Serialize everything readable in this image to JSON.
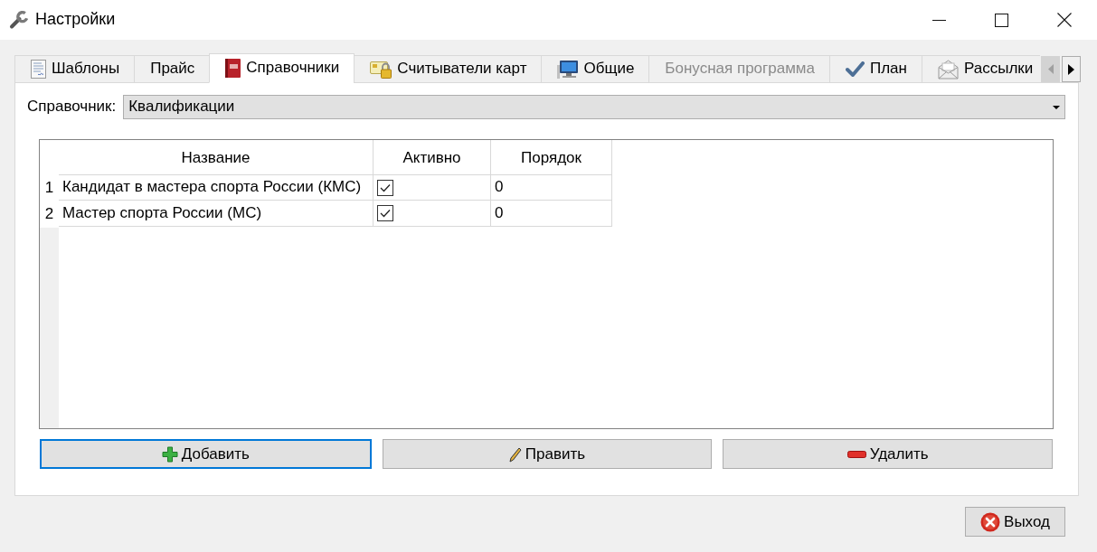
{
  "window": {
    "title": "Настройки"
  },
  "tabs": [
    {
      "label": "Шаблоны",
      "selected": false,
      "disabled": false
    },
    {
      "label": "Прайс",
      "selected": false,
      "disabled": false
    },
    {
      "label": "Справочники",
      "selected": true,
      "disabled": false
    },
    {
      "label": "Считыватели карт",
      "selected": false,
      "disabled": false
    },
    {
      "label": "Общие",
      "selected": false,
      "disabled": false
    },
    {
      "label": "Бонусная программа",
      "selected": false,
      "disabled": true
    },
    {
      "label": "План",
      "selected": false,
      "disabled": false
    },
    {
      "label": "Рассылки",
      "selected": false,
      "disabled": false
    }
  ],
  "tab_scroll": {
    "back_disabled": true,
    "forward_disabled": false
  },
  "directory": {
    "label": "Справочник:",
    "value": "Квалификации"
  },
  "table": {
    "columns": [
      "Название",
      "Активно",
      "Порядок"
    ],
    "rows": [
      {
        "number": "1",
        "name": "Кандидат в мастера спорта России (КМС)",
        "active": true,
        "order": "0"
      },
      {
        "number": "2",
        "name": "Мастер спорта России (МС)",
        "active": true,
        "order": "0"
      }
    ]
  },
  "actions": [
    {
      "label": "Добавить",
      "focused": true
    },
    {
      "label": "Править",
      "focused": false
    },
    {
      "label": "Удалить",
      "focused": false
    }
  ],
  "exit_button": {
    "label": "Выход"
  }
}
